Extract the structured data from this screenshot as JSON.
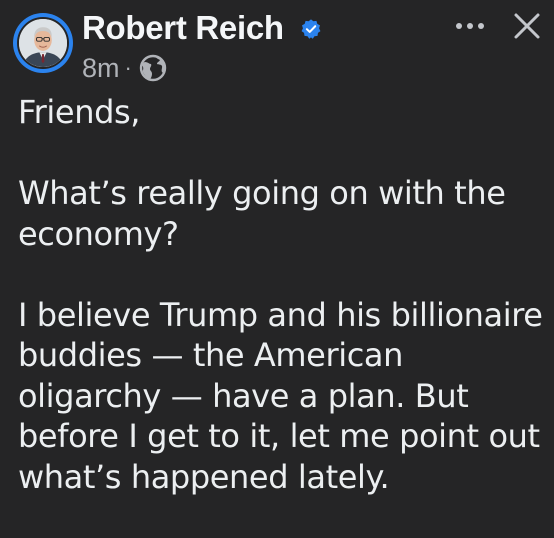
{
  "author": {
    "name": "Robert Reich",
    "verified": true,
    "avatar": "avatar-photo"
  },
  "meta": {
    "timestamp": "8m",
    "separator": "·",
    "audience_icon": "globe-icon"
  },
  "actions": {
    "more_icon": "more-horizontal-icon",
    "close_icon": "close-icon"
  },
  "post": {
    "paragraphs": [
      "Friends,",
      "What’s really going on with the economy?",
      "I believe Trump and his billionaire buddies — the American oligarchy — have a plan. But before I get to it, let me point out what’s happened lately."
    ]
  },
  "colors": {
    "background": "#252526",
    "text": "#eceff1",
    "muted": "#b0b3b8",
    "accent": "#2b83ee"
  }
}
